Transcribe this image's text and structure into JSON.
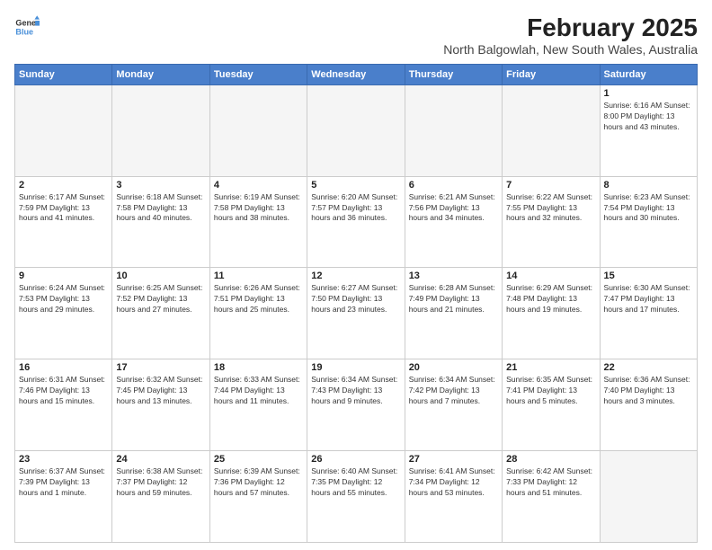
{
  "header": {
    "logo_line1": "General",
    "logo_line2": "Blue",
    "title": "February 2025",
    "subtitle": "North Balgowlah, New South Wales, Australia"
  },
  "weekdays": [
    "Sunday",
    "Monday",
    "Tuesday",
    "Wednesday",
    "Thursday",
    "Friday",
    "Saturday"
  ],
  "weeks": [
    [
      {
        "day": "",
        "empty": true
      },
      {
        "day": "",
        "empty": true
      },
      {
        "day": "",
        "empty": true
      },
      {
        "day": "",
        "empty": true
      },
      {
        "day": "",
        "empty": true
      },
      {
        "day": "",
        "empty": true
      },
      {
        "day": "1",
        "info": "Sunrise: 6:16 AM\nSunset: 8:00 PM\nDaylight: 13 hours\nand 43 minutes."
      }
    ],
    [
      {
        "day": "2",
        "info": "Sunrise: 6:17 AM\nSunset: 7:59 PM\nDaylight: 13 hours\nand 41 minutes."
      },
      {
        "day": "3",
        "info": "Sunrise: 6:18 AM\nSunset: 7:58 PM\nDaylight: 13 hours\nand 40 minutes."
      },
      {
        "day": "4",
        "info": "Sunrise: 6:19 AM\nSunset: 7:58 PM\nDaylight: 13 hours\nand 38 minutes."
      },
      {
        "day": "5",
        "info": "Sunrise: 6:20 AM\nSunset: 7:57 PM\nDaylight: 13 hours\nand 36 minutes."
      },
      {
        "day": "6",
        "info": "Sunrise: 6:21 AM\nSunset: 7:56 PM\nDaylight: 13 hours\nand 34 minutes."
      },
      {
        "day": "7",
        "info": "Sunrise: 6:22 AM\nSunset: 7:55 PM\nDaylight: 13 hours\nand 32 minutes."
      },
      {
        "day": "8",
        "info": "Sunrise: 6:23 AM\nSunset: 7:54 PM\nDaylight: 13 hours\nand 30 minutes."
      }
    ],
    [
      {
        "day": "9",
        "info": "Sunrise: 6:24 AM\nSunset: 7:53 PM\nDaylight: 13 hours\nand 29 minutes."
      },
      {
        "day": "10",
        "info": "Sunrise: 6:25 AM\nSunset: 7:52 PM\nDaylight: 13 hours\nand 27 minutes."
      },
      {
        "day": "11",
        "info": "Sunrise: 6:26 AM\nSunset: 7:51 PM\nDaylight: 13 hours\nand 25 minutes."
      },
      {
        "day": "12",
        "info": "Sunrise: 6:27 AM\nSunset: 7:50 PM\nDaylight: 13 hours\nand 23 minutes."
      },
      {
        "day": "13",
        "info": "Sunrise: 6:28 AM\nSunset: 7:49 PM\nDaylight: 13 hours\nand 21 minutes."
      },
      {
        "day": "14",
        "info": "Sunrise: 6:29 AM\nSunset: 7:48 PM\nDaylight: 13 hours\nand 19 minutes."
      },
      {
        "day": "15",
        "info": "Sunrise: 6:30 AM\nSunset: 7:47 PM\nDaylight: 13 hours\nand 17 minutes."
      }
    ],
    [
      {
        "day": "16",
        "info": "Sunrise: 6:31 AM\nSunset: 7:46 PM\nDaylight: 13 hours\nand 15 minutes."
      },
      {
        "day": "17",
        "info": "Sunrise: 6:32 AM\nSunset: 7:45 PM\nDaylight: 13 hours\nand 13 minutes."
      },
      {
        "day": "18",
        "info": "Sunrise: 6:33 AM\nSunset: 7:44 PM\nDaylight: 13 hours\nand 11 minutes."
      },
      {
        "day": "19",
        "info": "Sunrise: 6:34 AM\nSunset: 7:43 PM\nDaylight: 13 hours\nand 9 minutes."
      },
      {
        "day": "20",
        "info": "Sunrise: 6:34 AM\nSunset: 7:42 PM\nDaylight: 13 hours\nand 7 minutes."
      },
      {
        "day": "21",
        "info": "Sunrise: 6:35 AM\nSunset: 7:41 PM\nDaylight: 13 hours\nand 5 minutes."
      },
      {
        "day": "22",
        "info": "Sunrise: 6:36 AM\nSunset: 7:40 PM\nDaylight: 13 hours\nand 3 minutes."
      }
    ],
    [
      {
        "day": "23",
        "info": "Sunrise: 6:37 AM\nSunset: 7:39 PM\nDaylight: 13 hours\nand 1 minute."
      },
      {
        "day": "24",
        "info": "Sunrise: 6:38 AM\nSunset: 7:37 PM\nDaylight: 12 hours\nand 59 minutes."
      },
      {
        "day": "25",
        "info": "Sunrise: 6:39 AM\nSunset: 7:36 PM\nDaylight: 12 hours\nand 57 minutes."
      },
      {
        "day": "26",
        "info": "Sunrise: 6:40 AM\nSunset: 7:35 PM\nDaylight: 12 hours\nand 55 minutes."
      },
      {
        "day": "27",
        "info": "Sunrise: 6:41 AM\nSunset: 7:34 PM\nDaylight: 12 hours\nand 53 minutes."
      },
      {
        "day": "28",
        "info": "Sunrise: 6:42 AM\nSunset: 7:33 PM\nDaylight: 12 hours\nand 51 minutes."
      },
      {
        "day": "",
        "empty": true
      }
    ]
  ]
}
